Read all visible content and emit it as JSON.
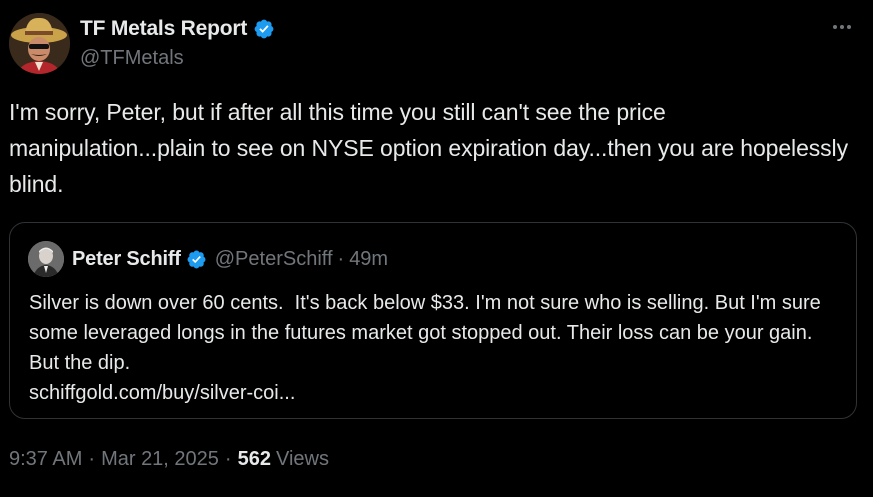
{
  "author": {
    "name": "TF Metals Report",
    "handle": "@TFMetals",
    "avatar_icon": "cowboy-avatar-icon",
    "verified_color": "#1d9bf0"
  },
  "tweet": {
    "text": "I'm sorry, Peter, but if after all this time you still can't see the price manipulation...plain to see on NYSE option expiration day...then you are hopelessly blind."
  },
  "quoted": {
    "name": "Peter Schiff",
    "handle": "@PeterSchiff",
    "separator": "·",
    "time": "49m",
    "text": "Silver is down over 60 cents.  It's back below $33. I'm not sure who is selling. But I'm sure some leveraged longs in the futures market got stopped out. Their loss can be your gain.  But the dip.",
    "link": "schiffgold.com/buy/silver-coi..."
  },
  "meta": {
    "time": "9:37 AM",
    "separator": "·",
    "date": "Mar 21, 2025",
    "separator2": "·",
    "views_count": "562",
    "views_label": "Views"
  },
  "icons": {
    "more": "more-options-icon",
    "verified": "verified-badge-icon"
  }
}
